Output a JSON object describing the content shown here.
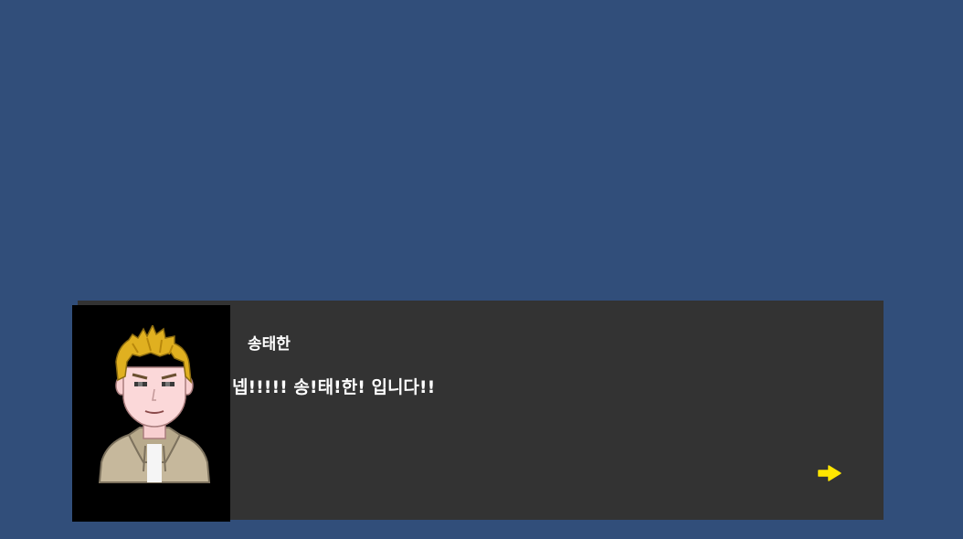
{
  "scene": {
    "background_color": "#314e7a"
  },
  "dialogue": {
    "speaker_name": "송태한",
    "text": "넵!!!!! 송!태!한! 입니다!!",
    "box_color": "#333333",
    "portrait": "character-portrait",
    "next_icon": "arrow-right-icon",
    "next_icon_color": "#ffe600"
  }
}
